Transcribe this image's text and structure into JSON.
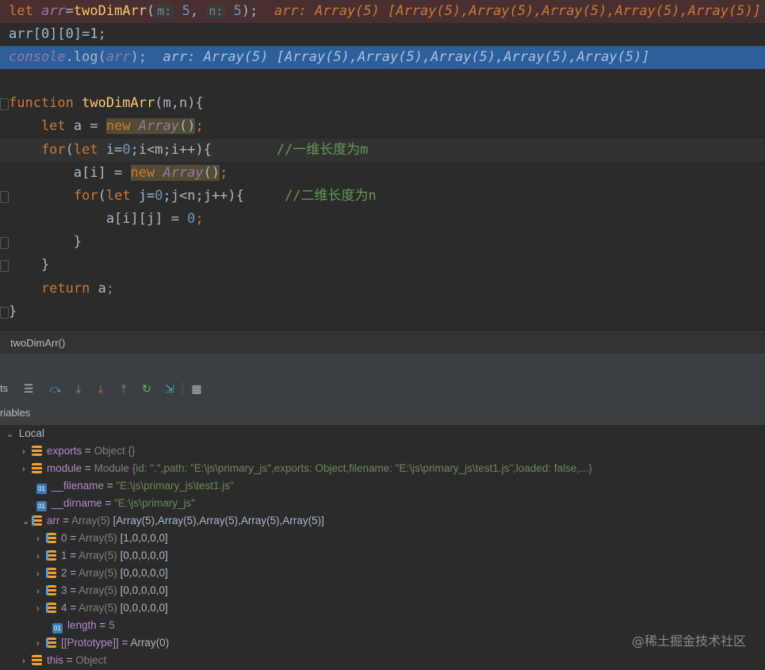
{
  "editor": {
    "line1": {
      "kw": "let ",
      "var": "arr",
      "eq": "=",
      "fn": "twoDimArr",
      "open": "(",
      "hint_m": "m:",
      "m": " 5",
      "comma": ", ",
      "hint_n": "n:",
      "n": " 5",
      "close": ");",
      "inlay": "  arr: Array(5) [Array(5),Array(5),Array(5),Array(5),Array(5)]"
    },
    "line2": {
      "text": "arr[0][0]=1;"
    },
    "line3": {
      "console": "console",
      "log": ".log(",
      "var": "arr",
      "close": ");",
      "inlay": "  arr: Array(5) [Array(5),Array(5),Array(5),Array(5),Array(5)]"
    },
    "line4": {
      "kw": "function ",
      "fn": "twoDimArr",
      "rest": "(m,n){"
    },
    "line5": {
      "kw": "    let ",
      "v": "a = ",
      "new": "new ",
      "cls": "Array",
      "paren": "()",
      "semi": ";"
    },
    "line6": {
      "kw": "    for",
      "p1": "(",
      "let": "let ",
      "v": "i=",
      "z": "0",
      "rest": ";i<m;i++){",
      "cm": "        //一维长度为m"
    },
    "line7": {
      "v": "        a[i] = ",
      "new": "new ",
      "cls": "Array",
      "paren": "()",
      "semi": ";"
    },
    "line8": {
      "kw": "        for",
      "p1": "(",
      "let": "let ",
      "v": "j=",
      "z": "0",
      "rest": ";j<n;j++){",
      "cm": "     //二维长度为n"
    },
    "line9": {
      "v": "            a[i][j] = ",
      "z": "0",
      "semi": ";"
    },
    "line10": {
      "text": "        }"
    },
    "line11": {
      "text": "    }"
    },
    "line12": {
      "kw": "    return ",
      "v": "a",
      "semi": ";"
    },
    "line13": {
      "text": "}"
    }
  },
  "breadcrumb": "twoDimArr()",
  "toolbar": {
    "label": "ts"
  },
  "variables": {
    "header": "riables",
    "local": "Local",
    "rows": [
      {
        "name": "exports",
        "eq": " = ",
        "type": "Object {}",
        "rest": ""
      },
      {
        "name": "module",
        "eq": " = ",
        "type": "Module {",
        "rest": "id: \".\",path: \"E:\\js\\primary_js\",exports: Object,filename: \"E:\\js\\primary_js\\test1.js\",loaded: false,...}"
      },
      {
        "name": "__filename",
        "eq": " = ",
        "type": "",
        "rest": "\"E:\\js\\primary_js\\test1.js\""
      },
      {
        "name": "__dirname",
        "eq": " = ",
        "type": "",
        "rest": "\"E:\\js\\primary_js\""
      },
      {
        "name": "arr",
        "eq": " = ",
        "type": "Array(5) ",
        "rest": "[Array(5),Array(5),Array(5),Array(5),Array(5)]"
      },
      {
        "name": "0",
        "eq": " = ",
        "type": "Array(5) ",
        "rest": "[1,0,0,0,0]"
      },
      {
        "name": "1",
        "eq": " = ",
        "type": "Array(5) ",
        "rest": "[0,0,0,0,0]"
      },
      {
        "name": "2",
        "eq": " = ",
        "type": "Array(5) ",
        "rest": "[0,0,0,0,0]"
      },
      {
        "name": "3",
        "eq": " = ",
        "type": "Array(5) ",
        "rest": "[0,0,0,0,0]"
      },
      {
        "name": "4",
        "eq": " = ",
        "type": "Array(5) ",
        "rest": "[0,0,0,0,0]"
      },
      {
        "name": "length",
        "eq": " = ",
        "type": "",
        "rest": "5"
      },
      {
        "name": "[[Prototype]]",
        "eq": " = ",
        "type": "",
        "rest": "Array(0)"
      },
      {
        "name": "this",
        "eq": " = ",
        "type": "Object",
        "rest": ""
      }
    ]
  },
  "watermark": "@稀土掘金技术社区"
}
